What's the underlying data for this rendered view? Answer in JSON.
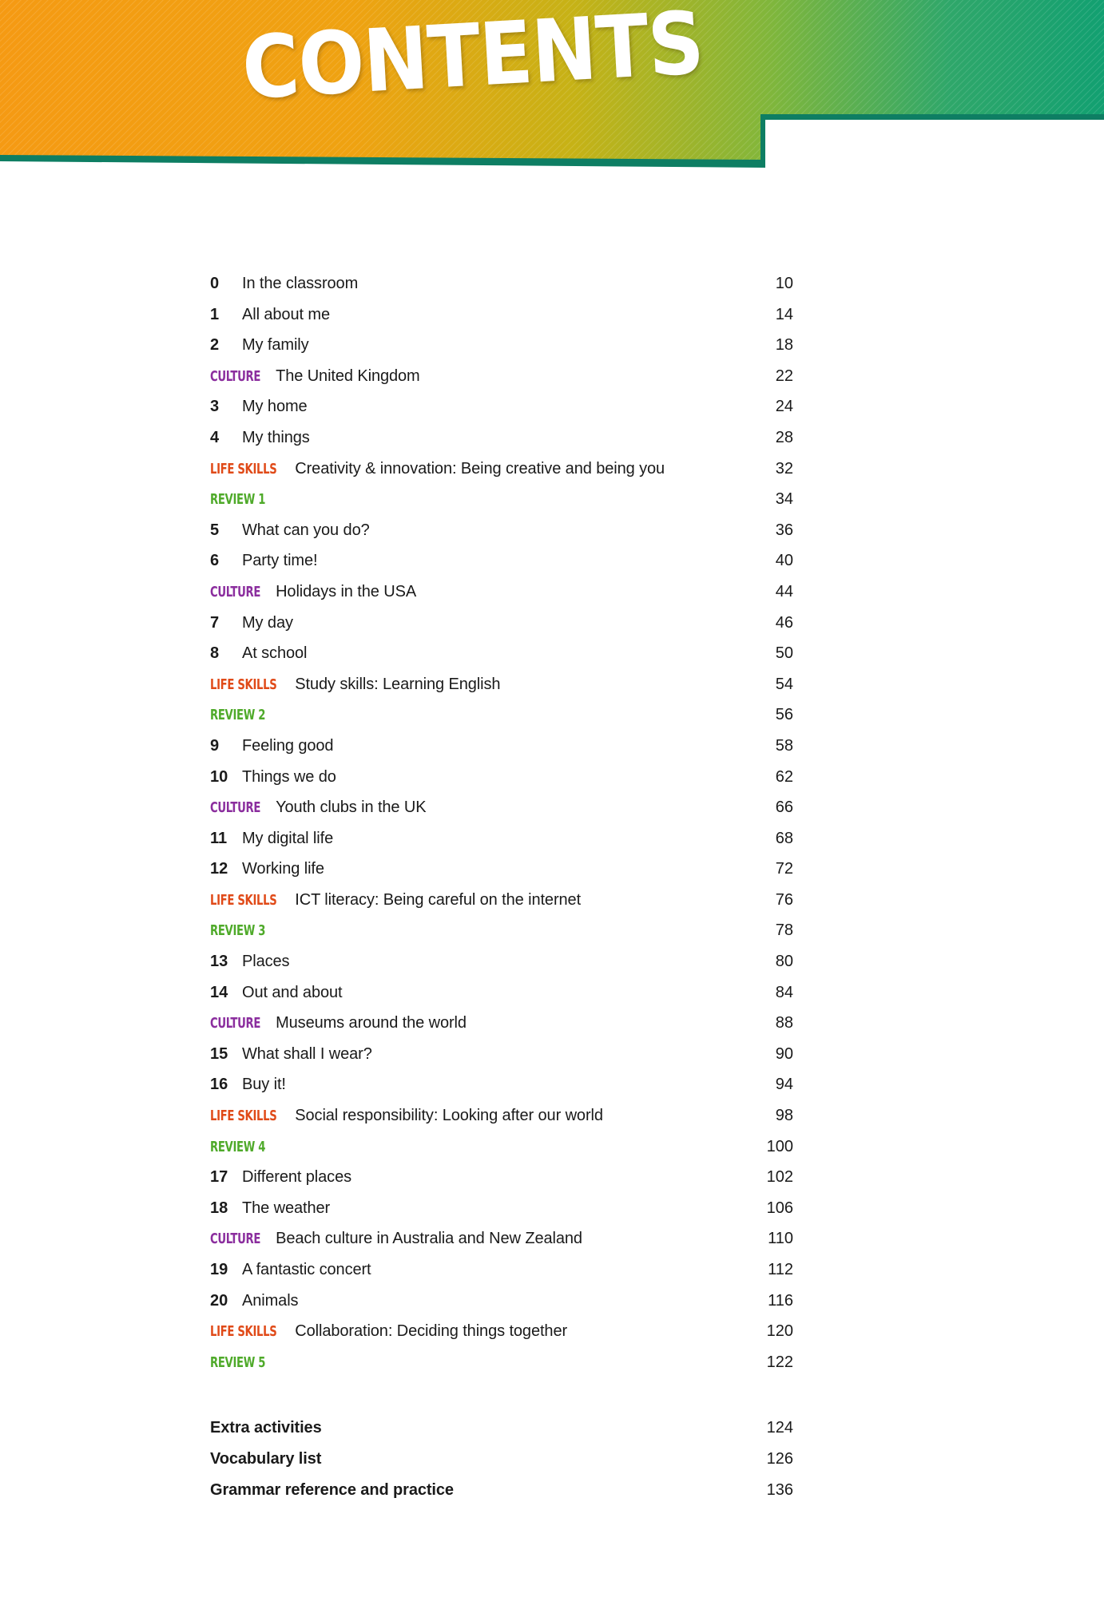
{
  "header": {
    "title": "CONTENTS",
    "gradient_start": "#F59A13",
    "gradient_mid": "#C9B215",
    "gradient_end": "#17A06E",
    "border_color": "#0E7E63"
  },
  "colors": {
    "culture": "#8B2E9E",
    "life_skills": "#E04A18",
    "review": "#4FAA2A",
    "text": "#1a1a1a"
  },
  "toc": {
    "entries": [
      {
        "kind": "unit",
        "num": "0",
        "title": "In the classroom",
        "page": "10"
      },
      {
        "kind": "unit",
        "num": "1",
        "title": "All about me",
        "page": "14"
      },
      {
        "kind": "unit",
        "num": "2",
        "title": "My family",
        "page": "18"
      },
      {
        "kind": "culture",
        "label": "CULTURE",
        "title": "The United Kingdom",
        "page": "22"
      },
      {
        "kind": "unit",
        "num": "3",
        "title": "My home",
        "page": "24"
      },
      {
        "kind": "unit",
        "num": "4",
        "title": "My things",
        "page": "28"
      },
      {
        "kind": "lifeskills",
        "label": "LIFE SKILLS",
        "title": "Creativity & innovation: Being creative and being you",
        "page": "32"
      },
      {
        "kind": "review",
        "label": "REVIEW 1",
        "title": "",
        "page": "34"
      },
      {
        "kind": "unit",
        "num": "5",
        "title": "What can you do?",
        "page": "36"
      },
      {
        "kind": "unit",
        "num": "6",
        "title": "Party time!",
        "page": "40"
      },
      {
        "kind": "culture",
        "label": "CULTURE",
        "title": "Holidays in the USA",
        "page": "44"
      },
      {
        "kind": "unit",
        "num": "7",
        "title": "My day",
        "page": "46"
      },
      {
        "kind": "unit",
        "num": "8",
        "title": "At school",
        "page": "50"
      },
      {
        "kind": "lifeskills",
        "label": "LIFE SKILLS",
        "title": "Study skills: Learning English",
        "page": "54"
      },
      {
        "kind": "review",
        "label": "REVIEW 2",
        "title": "",
        "page": "56"
      },
      {
        "kind": "unit",
        "num": "9",
        "title": "Feeling good",
        "page": "58"
      },
      {
        "kind": "unit",
        "num": "10",
        "title": "Things we do",
        "page": "62"
      },
      {
        "kind": "culture",
        "label": "CULTURE",
        "title": "Youth clubs in the UK",
        "page": "66"
      },
      {
        "kind": "unit",
        "num": "11",
        "title": "My digital life",
        "page": "68"
      },
      {
        "kind": "unit",
        "num": "12",
        "title": "Working life",
        "page": "72"
      },
      {
        "kind": "lifeskills",
        "label": "LIFE SKILLS",
        "title": "ICT literacy: Being careful on the internet",
        "page": "76"
      },
      {
        "kind": "review",
        "label": "REVIEW 3",
        "title": "",
        "page": "78"
      },
      {
        "kind": "unit",
        "num": "13",
        "title": "Places",
        "page": "80"
      },
      {
        "kind": "unit",
        "num": "14",
        "title": "Out and about",
        "page": "84"
      },
      {
        "kind": "culture",
        "label": "CULTURE",
        "title": "Museums around the world",
        "page": "88"
      },
      {
        "kind": "unit",
        "num": "15",
        "title": "What shall I wear?",
        "page": "90"
      },
      {
        "kind": "unit",
        "num": "16",
        "title": "Buy it!",
        "page": "94"
      },
      {
        "kind": "lifeskills",
        "label": "LIFE SKILLS",
        "title": "Social responsibility: Looking after our world",
        "page": "98"
      },
      {
        "kind": "review",
        "label": "REVIEW 4",
        "title": "",
        "page": "100"
      },
      {
        "kind": "unit",
        "num": "17",
        "title": "Different places",
        "page": "102"
      },
      {
        "kind": "unit",
        "num": "18",
        "title": "The weather",
        "page": "106"
      },
      {
        "kind": "culture",
        "label": "CULTURE",
        "title": "Beach culture in Australia and New Zealand",
        "page": "110"
      },
      {
        "kind": "unit",
        "num": "19",
        "title": "A fantastic concert",
        "page": "112"
      },
      {
        "kind": "unit",
        "num": "20",
        "title": "Animals",
        "page": "116"
      },
      {
        "kind": "lifeskills",
        "label": "LIFE SKILLS",
        "title": "Collaboration: Deciding things together",
        "page": "120"
      },
      {
        "kind": "review",
        "label": "REVIEW 5",
        "title": "",
        "page": "122"
      }
    ],
    "back_matter": [
      {
        "kind": "bold",
        "title": "Extra activities",
        "page": "124"
      },
      {
        "kind": "bold",
        "title": "Vocabulary list",
        "page": "126"
      },
      {
        "kind": "bold",
        "title": "Grammar reference and practice",
        "page": "136"
      }
    ]
  }
}
